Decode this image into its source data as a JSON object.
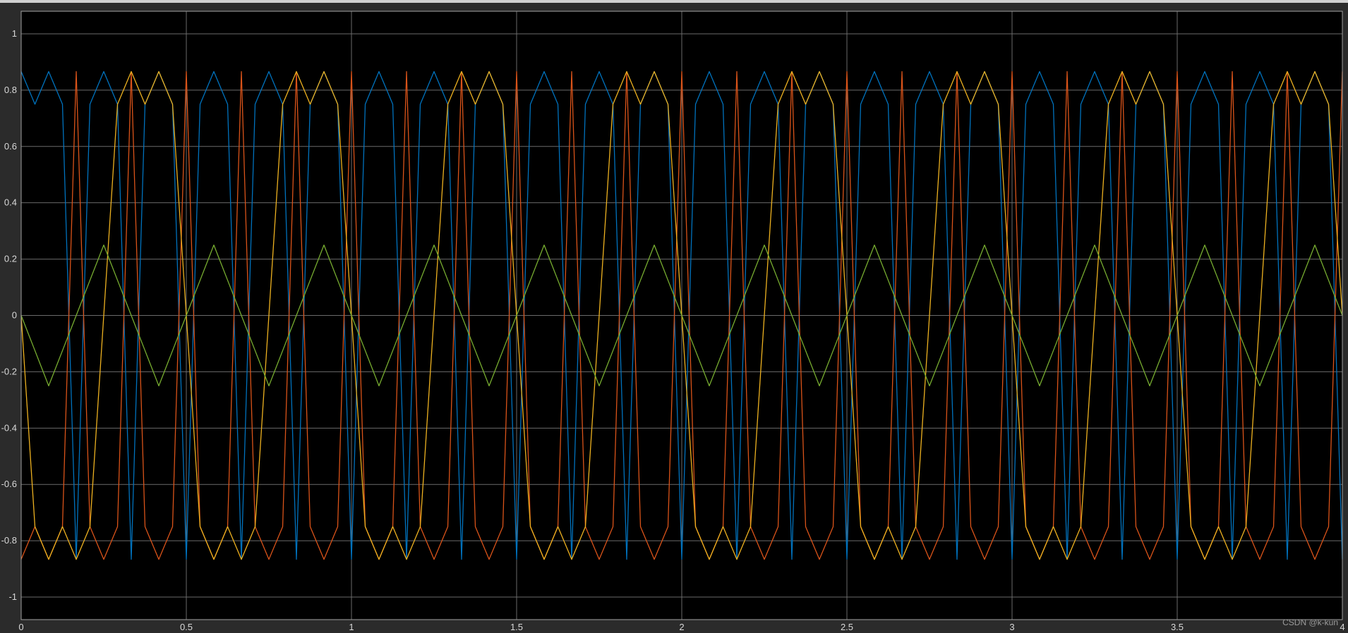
{
  "watermark": "CSDN @k-kun",
  "chart_data": {
    "type": "line",
    "title": "",
    "xlabel": "",
    "ylabel": "",
    "xlim": [
      0,
      4
    ],
    "ylim": [
      -1.08,
      1.08
    ],
    "grid": true,
    "legend": "none",
    "background": "#000000",
    "grid_color": "#6a6a6a",
    "frame_color": "#a0a0a0",
    "x_ticks": [
      0,
      0.5,
      1,
      1.5,
      2,
      2.5,
      3,
      3.5,
      4
    ],
    "x_tick_labels": [
      "0",
      "0.5",
      "1",
      "1.5",
      "2",
      "2.5",
      "3",
      "3.5",
      "4"
    ],
    "y_ticks": [
      1,
      0.8,
      0.6,
      0.4,
      0.2,
      0,
      -0.2,
      -0.4,
      -0.6,
      -0.8,
      -1
    ],
    "y_tick_labels": [
      "1",
      "0.8",
      "0.6",
      "0.4",
      "0.2",
      "0",
      "-0.2",
      "-0.4",
      "-0.6",
      "-0.8",
      "-1"
    ],
    "x": [
      0,
      0.0417,
      0.0833,
      0.125,
      0.1667,
      0.2083,
      0.25,
      0.2917,
      0.3333,
      0.375,
      0.4167,
      0.4583,
      0.5,
      0.5417,
      0.5833,
      0.625,
      0.6667,
      0.7083,
      0.75,
      0.7917,
      0.8333,
      0.875,
      0.9167,
      0.9583,
      1,
      1.0417,
      1.0833,
      1.125,
      1.1667,
      1.2083,
      1.25,
      1.2917,
      1.3333,
      1.375,
      1.4167,
      1.4583,
      1.5,
      1.5417,
      1.5833,
      1.625,
      1.6667,
      1.7083,
      1.75,
      1.7917,
      1.8333,
      1.875,
      1.9167,
      1.9583,
      2,
      2.0417,
      2.0833,
      2.125,
      2.1667,
      2.2083,
      2.25,
      2.2917,
      2.3333,
      2.375,
      2.4167,
      2.4583,
      2.5,
      2.5417,
      2.5833,
      2.625,
      2.6667,
      2.7083,
      2.75,
      2.7917,
      2.8333,
      2.875,
      2.9167,
      2.9583,
      3,
      3.0417,
      3.0833,
      3.125,
      3.1667,
      3.2083,
      3.25,
      3.2917,
      3.3333,
      3.375,
      3.4167,
      3.4583,
      3.5,
      3.5417,
      3.5833,
      3.625,
      3.6667,
      3.7083,
      3.75,
      3.7917,
      3.8333,
      3.875,
      3.9167,
      3.9583,
      4
    ],
    "series": [
      {
        "color": "#0072BD",
        "values": [
          0.866,
          0.75,
          0.866,
          0.75,
          -0.866,
          0.75,
          0.866,
          0.75,
          -0.866,
          0.75,
          0.866,
          0.75,
          -0.866,
          0.75,
          0.866,
          0.75,
          -0.866,
          0.75,
          0.866,
          0.75,
          -0.866,
          0.75,
          0.866,
          0.75,
          -0.866,
          0.75,
          0.866,
          0.75,
          -0.866,
          0.75,
          0.866,
          0.75,
          -0.866,
          0.75,
          0.866,
          0.75,
          -0.866,
          0.75,
          0.866,
          0.75,
          -0.866,
          0.75,
          0.866,
          0.75,
          -0.866,
          0.75,
          0.866,
          0.75,
          -0.866,
          0.75,
          0.866,
          0.75,
          -0.866,
          0.75,
          0.866,
          0.75,
          -0.866,
          0.75,
          0.866,
          0.75,
          -0.866,
          0.75,
          0.866,
          0.75,
          -0.866,
          0.75,
          0.866,
          0.75,
          -0.866,
          0.75,
          0.866,
          0.75,
          -0.866,
          0.75,
          0.866,
          0.75,
          -0.866,
          0.75,
          0.866,
          0.75,
          -0.866,
          0.75,
          0.866,
          0.75,
          -0.866,
          0.75,
          0.866,
          0.75,
          -0.866,
          0.75,
          0.866,
          0.75,
          -0.866,
          0.75,
          0.866,
          0.75,
          -0.866
        ]
      },
      {
        "color": "#D95319",
        "values": [
          -0.866,
          -0.75,
          -0.866,
          -0.75,
          0.866,
          -0.75,
          -0.866,
          -0.75,
          0.866,
          -0.75,
          -0.866,
          -0.75,
          0.866,
          -0.75,
          -0.866,
          -0.75,
          0.866,
          -0.75,
          -0.866,
          -0.75,
          0.866,
          -0.75,
          -0.866,
          -0.75,
          0.866,
          -0.75,
          -0.866,
          -0.75,
          0.866,
          -0.75,
          -0.866,
          -0.75,
          0.866,
          -0.75,
          -0.866,
          -0.75,
          0.866,
          -0.75,
          -0.866,
          -0.75,
          0.866,
          -0.75,
          -0.866,
          -0.75,
          0.866,
          -0.75,
          -0.866,
          -0.75,
          0.866,
          -0.75,
          -0.866,
          -0.75,
          0.866,
          -0.75,
          -0.866,
          -0.75,
          0.866,
          -0.75,
          -0.866,
          -0.75,
          0.866,
          -0.75,
          -0.866,
          -0.75,
          0.866,
          -0.75,
          -0.866,
          -0.75,
          0.866,
          -0.75,
          -0.866,
          -0.75,
          0.866,
          -0.75,
          -0.866,
          -0.75,
          0.866,
          -0.75,
          -0.866,
          -0.75,
          0.866,
          -0.75,
          -0.866,
          -0.75,
          0.866,
          -0.75,
          -0.866,
          -0.75,
          0.866,
          -0.75,
          -0.866,
          -0.75,
          0.866,
          -0.75,
          -0.866,
          -0.75,
          0.866
        ]
      },
      {
        "color": "#EDB120",
        "values": [
          0,
          -0.75,
          -0.866,
          -0.75,
          -0.866,
          -0.75,
          0,
          0.75,
          0.866,
          0.75,
          0.866,
          0.75,
          0,
          -0.75,
          -0.866,
          -0.75,
          -0.866,
          -0.75,
          0,
          0.75,
          0.866,
          0.75,
          0.866,
          0.75,
          0,
          -0.75,
          -0.866,
          -0.75,
          -0.866,
          -0.75,
          0,
          0.75,
          0.866,
          0.75,
          0.866,
          0.75,
          0,
          -0.75,
          -0.866,
          -0.75,
          -0.866,
          -0.75,
          0,
          0.75,
          0.866,
          0.75,
          0.866,
          0.75,
          0,
          -0.75,
          -0.866,
          -0.75,
          -0.866,
          -0.75,
          0,
          0.75,
          0.866,
          0.75,
          0.866,
          0.75,
          0,
          -0.75,
          -0.866,
          -0.75,
          -0.866,
          -0.75,
          0,
          0.75,
          0.866,
          0.75,
          0.866,
          0.75,
          0,
          -0.75,
          -0.866,
          -0.75,
          -0.866,
          -0.75,
          0,
          0.75,
          0.866,
          0.75,
          0.866,
          0.75,
          0,
          -0.75,
          -0.866,
          -0.75,
          -0.866,
          -0.75,
          0,
          0.75,
          0.866,
          0.75,
          0.866,
          0.75,
          0
        ]
      },
      {
        "color": "#77AC30",
        "values": [
          0,
          -0.125,
          -0.25,
          -0.125,
          0,
          0.125,
          0.25,
          0.125,
          0,
          -0.125,
          -0.25,
          -0.125,
          0,
          0.125,
          0.25,
          0.125,
          0,
          -0.125,
          -0.25,
          -0.125,
          0,
          0.125,
          0.25,
          0.125,
          0,
          -0.125,
          -0.25,
          -0.125,
          0,
          0.125,
          0.25,
          0.125,
          0,
          -0.125,
          -0.25,
          -0.125,
          0,
          0.125,
          0.25,
          0.125,
          0,
          -0.125,
          -0.25,
          -0.125,
          0,
          0.125,
          0.25,
          0.125,
          0,
          -0.125,
          -0.25,
          -0.125,
          0,
          0.125,
          0.25,
          0.125,
          0,
          -0.125,
          -0.25,
          -0.125,
          0,
          0.125,
          0.25,
          0.125,
          0,
          -0.125,
          -0.25,
          -0.125,
          0,
          0.125,
          0.25,
          0.125,
          0,
          -0.125,
          -0.25,
          -0.125,
          0,
          0.125,
          0.25,
          0.125,
          0,
          -0.125,
          -0.25,
          -0.125,
          0,
          0.125,
          0.25,
          0.125,
          0,
          -0.125,
          -0.25,
          -0.125,
          0,
          0.125,
          0.25,
          0.125,
          0
        ]
      }
    ]
  }
}
